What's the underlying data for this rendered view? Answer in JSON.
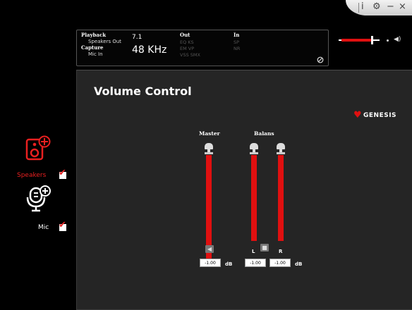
{
  "window_controls": {
    "info_icon": "info-icon",
    "settings_icon": "gear-icon",
    "minimize_label": "−",
    "close_label": "×"
  },
  "info": {
    "playback_label": "Playback",
    "playback_channels": "7.1",
    "playback_device": "Speakers Out",
    "capture_label": "Capture",
    "capture_device": "Mic In",
    "sample_rate": "48 KHz",
    "out_label": "Out",
    "out_flags_row1": "EQ  KS",
    "out_flags_row2": "EM  VP",
    "out_flags_row3": "VSS  SMX",
    "in_label": "In",
    "in_flags_row1": "SP",
    "in_flags_row2": "NR"
  },
  "master_slider": {
    "level": 0.8,
    "dot_icon": "dot-icon",
    "speaker_icon": "speaker-icon"
  },
  "panel": {
    "title": "Volume Control",
    "brand": "GENESIS"
  },
  "channels": {
    "master_label": "Master",
    "balans_label": "Balans",
    "left_label": "L",
    "right_label": "R",
    "master_db": "-1.00",
    "left_db": "-1.00",
    "right_db": "-1.00",
    "db_unit": "dB",
    "master_level": 0.97,
    "left_level": 0.97,
    "right_level": 0.97
  },
  "sidebar": {
    "speakers_label": "Speakers",
    "speakers_checked": true,
    "mic_label": "Mic",
    "mic_checked": true
  },
  "colors": {
    "accent": "#e01010",
    "panel_bg": "#252525",
    "background": "#000000"
  }
}
